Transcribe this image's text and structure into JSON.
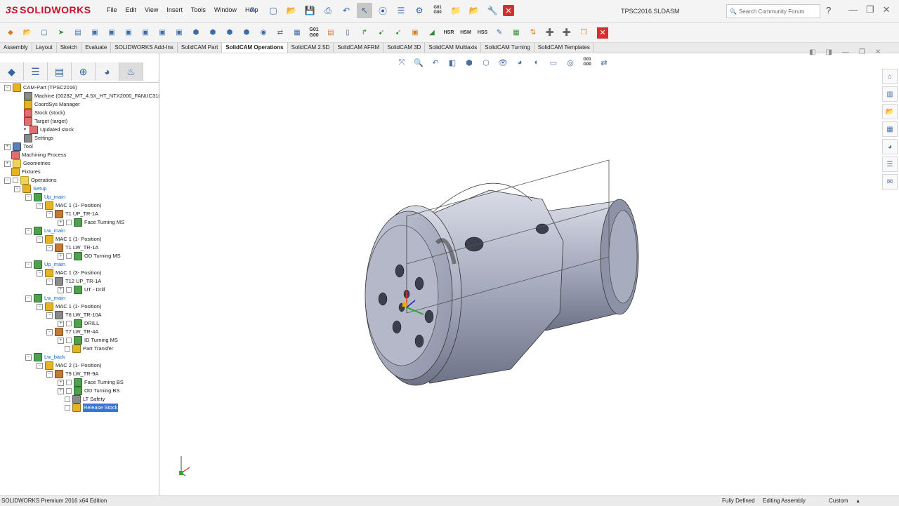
{
  "app": {
    "logo": "SOLIDWORKS",
    "logo_mark": "3S"
  },
  "menu": [
    "File",
    "Edit",
    "View",
    "Insert",
    "Tools",
    "Window",
    "Help"
  ],
  "doc_title": "TPSC2016.SLDASM",
  "search": {
    "placeholder": "Search Community Forum"
  },
  "tabs": [
    "Assembly",
    "Layout",
    "Sketch",
    "Evaluate",
    "SOLIDWORKS Add-Ins",
    "SolidCAM Part",
    "SolidCAM Operations",
    "SolidCAM 2.5D",
    "SolidCAM AFRM",
    "SolidCAM 3D",
    "SolidCAM Multiaxis",
    "SolidCAM Turning",
    "SolidCAM Templates"
  ],
  "active_tab": "SolidCAM Operations",
  "toolbar_codes": {
    "g01": "G01\nG00",
    "hsr": "HSR",
    "hsm": "HSM",
    "hss": "HSS"
  },
  "tree": {
    "cam_part": "CAM-Part (TPSC2016)",
    "machine": "Machine (00282_MT_4.5X_HT_NTX2000_FANUC31i)",
    "coordsys": "CoordSys Manager",
    "stock": "Stock (stock)",
    "target": "Target (target)",
    "updated_stock": "Updated stock",
    "settings": "Settings",
    "tool": "Tool",
    "machining_process": "Machining Process",
    "geometries": "Geometries",
    "fixtures": "Fixtures",
    "operations": "Operations",
    "setup": "Setup",
    "groups": [
      {
        "name": "Up_main",
        "mac": "MAC 1 (1- Position)",
        "tools": [
          {
            "name": "T1 UP_TR-1A",
            "ops": [
              "Face Turning MS"
            ]
          }
        ]
      },
      {
        "name": "Lw_main",
        "mac": "MAC 1 (1- Position)",
        "tools": [
          {
            "name": "T1 LW_TR-1A",
            "ops": [
              "OD Turning MS"
            ]
          }
        ]
      },
      {
        "name": "Up_main",
        "mac": "MAC 1 (3- Position)",
        "tools": [
          {
            "name": "T12 UP_TR-1A",
            "ops": [
              "UT - Drill"
            ]
          }
        ]
      },
      {
        "name": "Lw_main",
        "mac": "MAC 1 (1- Position)",
        "tools": [
          {
            "name": "T6 LW_TR-10A",
            "ops": [
              "DRILL"
            ]
          },
          {
            "name": "T7 LW_TR-4A",
            "ops": [
              "ID Turning MS",
              "Part Transfer"
            ]
          }
        ]
      },
      {
        "name": "Lw_back",
        "mac": "MAC 2 (1- Position)",
        "tools": [
          {
            "name": "T9 LW_TR-9A",
            "ops": [
              "Face Turning BS",
              "OD Turning BS",
              "LT Safety",
              "Release Stock"
            ]
          }
        ]
      }
    ]
  },
  "status": {
    "left": "SOLIDWORKS Premium 2016 x64 Edition",
    "fully_defined": "Fully Defined",
    "editing": "Editing Assembly",
    "units": "Custom"
  }
}
